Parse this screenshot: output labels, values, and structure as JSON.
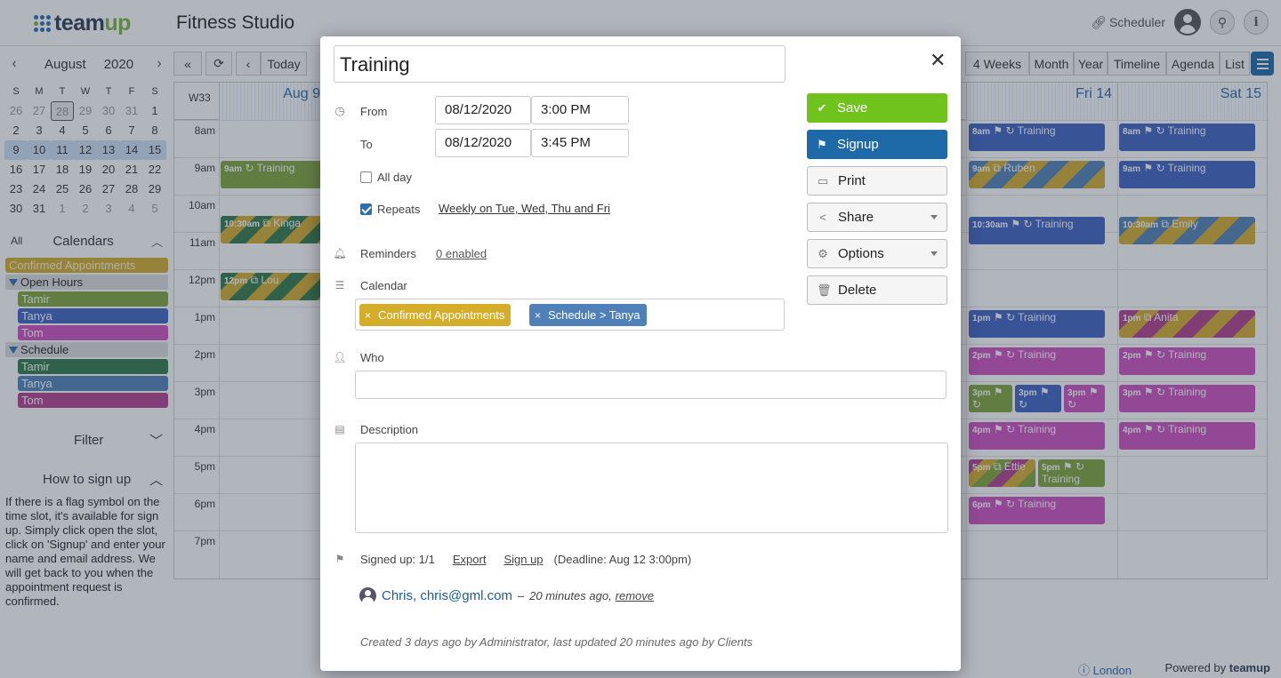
{
  "app": {
    "logo_text": "team",
    "logo_text_accent": "up",
    "calendar_title": "Fitness Studio"
  },
  "topbar": {
    "scheduler_label": "Scheduler",
    "search_icon": "search-icon",
    "info_icon": "info-icon"
  },
  "minical": {
    "month": "August",
    "year": "2020",
    "dow": [
      "S",
      "M",
      "T",
      "W",
      "T",
      "F",
      "S"
    ],
    "weeks": [
      [
        "26",
        "27",
        "28",
        "29",
        "30",
        "31",
        "1"
      ],
      [
        "2",
        "3",
        "4",
        "5",
        "6",
        "7",
        "8"
      ],
      [
        "9",
        "10",
        "11",
        "12",
        "13",
        "14",
        "15"
      ],
      [
        "16",
        "17",
        "18",
        "19",
        "20",
        "21",
        "22"
      ],
      [
        "23",
        "24",
        "25",
        "26",
        "27",
        "28",
        "29"
      ],
      [
        "30",
        "31",
        "1",
        "2",
        "3",
        "4",
        "5"
      ]
    ]
  },
  "calendars": {
    "all_label": "All",
    "title": "Calendars",
    "confirmed": "Confirmed Appointments",
    "open_hours": "Open Hours",
    "open_items": [
      "Tamir",
      "Tanya",
      "Tom"
    ],
    "schedule": "Schedule",
    "schedule_items": [
      "Tamir",
      "Tanya",
      "Tom"
    ],
    "colors": {
      "confirmed": "#d4ad2a",
      "tamir_open": "#7fa53a",
      "tanya_open": "#3d62c2",
      "tom_open": "#cd4fbf",
      "tamir_sched": "#2f7a4a",
      "tanya_sched": "#4f81b8",
      "tom_sched": "#b2408f"
    }
  },
  "sidebar": {
    "filter_label": "Filter",
    "howto_title": "How to sign up",
    "howto_text": "If there is a flag symbol on the time slot, it's available for sign up. Simply click open the slot, click on 'Signup' and enter your name and email address. We will get back to you when the appointment request is confirmed."
  },
  "toolbar": {
    "today": "Today",
    "views": [
      "4 Weeks",
      "Month",
      "Year",
      "Timeline",
      "Agenda",
      "List"
    ]
  },
  "grid": {
    "week_label": "W33",
    "days": [
      "Aug 9",
      "Fri 14",
      "Sat 15"
    ],
    "hours": [
      "8am",
      "9am",
      "10am",
      "11am",
      "12pm",
      "1pm",
      "2pm",
      "3pm",
      "4pm",
      "5pm",
      "6pm",
      "7pm"
    ]
  },
  "events": [
    {
      "time": "9am",
      "title": "Training"
    },
    {
      "time": "10:30am",
      "title": "Kinga"
    },
    {
      "time": "12pm",
      "title": "Lou"
    },
    {
      "time": "8am",
      "title": "Training"
    },
    {
      "time": "9am",
      "title": "Ruben"
    },
    {
      "time": "10:30am",
      "title": "Training"
    },
    {
      "time": "1pm",
      "title": "Training"
    },
    {
      "time": "2pm",
      "title": "Training"
    },
    {
      "time": "3pm",
      "title": ""
    },
    {
      "time": "3pm",
      "title": ""
    },
    {
      "time": "3pm",
      "title": ""
    },
    {
      "time": "4pm",
      "title": "Training"
    },
    {
      "time": "5pm",
      "title": "Ettie"
    },
    {
      "time": "5pm",
      "title": "Training"
    },
    {
      "time": "6pm",
      "title": "Training"
    },
    {
      "time": "8am",
      "title": "Training"
    },
    {
      "time": "9am",
      "title": "Training"
    },
    {
      "time": "10:30am",
      "title": "Emily"
    },
    {
      "time": "1pm",
      "title": "Anita"
    },
    {
      "time": "2pm",
      "title": "Training"
    },
    {
      "time": "3pm",
      "title": "Training"
    },
    {
      "time": "4pm",
      "title": "Training"
    }
  ],
  "footer": {
    "timezone": "London",
    "powered_by": "Powered by",
    "brand": "teamup"
  },
  "modal": {
    "title": "Training",
    "from_label": "From",
    "from_date": "08/12/2020",
    "from_time": "3:00 PM",
    "to_label": "To",
    "to_date": "08/12/2020",
    "to_time": "3:45 PM",
    "allday_label": "All day",
    "allday_checked": false,
    "repeats_label": "Repeats",
    "repeats_checked": true,
    "repeats_rule": "Weekly on Tue, Wed, Thu and Fri",
    "reminders_label": "Reminders",
    "reminders_value": "0 enabled",
    "calendar_label": "Calendar",
    "calendar_tags": [
      {
        "label": "Confirmed Appointments",
        "color": "#d4ad2a"
      },
      {
        "label": "Schedule > Tanya",
        "color": "#4f81b8"
      }
    ],
    "who_label": "Who",
    "who_value": "",
    "description_label": "Description",
    "description_value": "",
    "buttons": {
      "save": "Save",
      "signup": "Signup",
      "print": "Print",
      "share": "Share",
      "options": "Options",
      "delete": "Delete"
    },
    "signed_up": "Signed up: 1/1",
    "export": "Export",
    "sign_up": "Sign up",
    "deadline": "(Deadline: Aug 12 3:00pm)",
    "attendee_name": "Chris, chris@gml.com",
    "attendee_dash": "–",
    "attendee_time": "20 minutes ago,",
    "attendee_remove": "remove",
    "created": "Created 3 days ago by Administrator, last updated 20 minutes ago by Clients"
  }
}
